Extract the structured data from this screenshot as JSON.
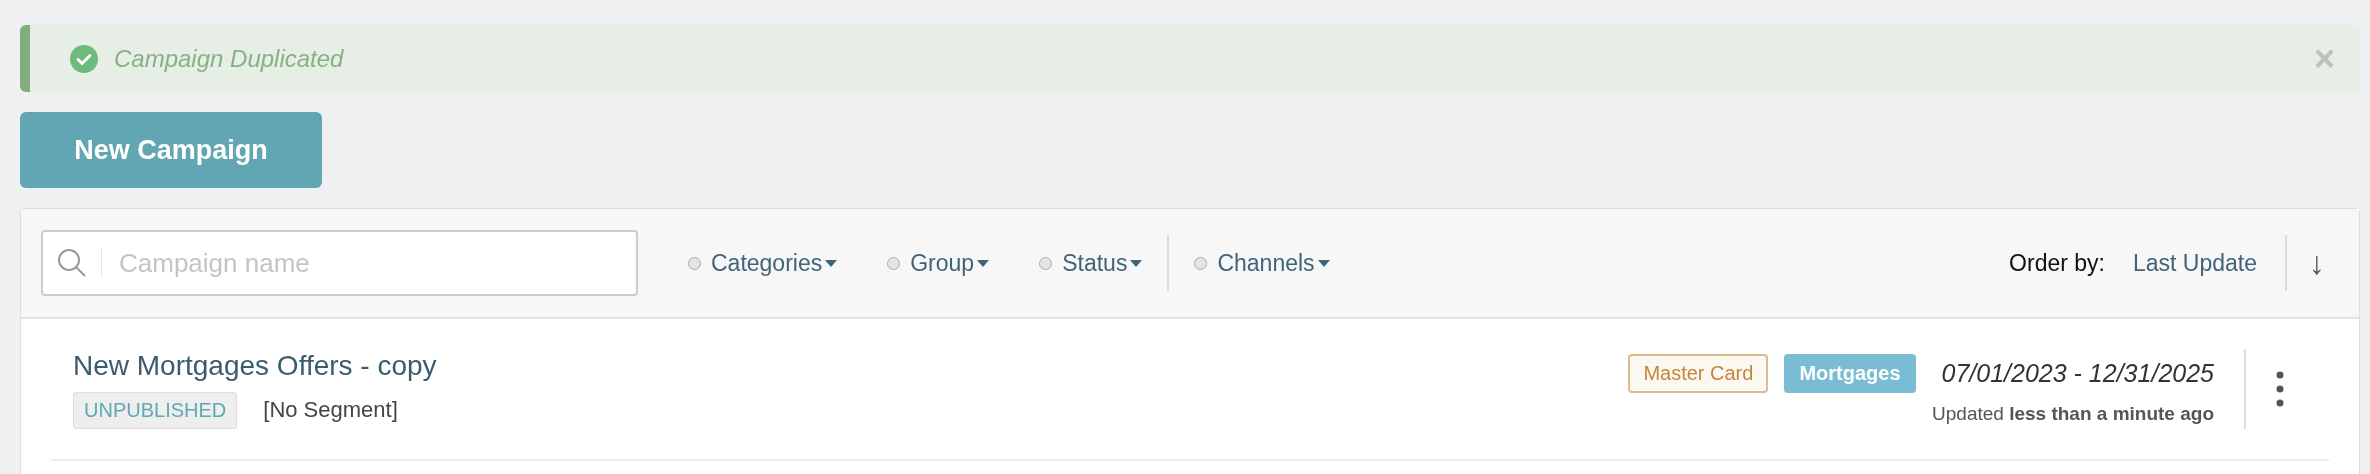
{
  "alert": {
    "message": "Campaign Duplicated",
    "close": "×"
  },
  "new_button": "New Campaign",
  "search": {
    "placeholder": "Campaign name"
  },
  "filters": [
    {
      "label": "Categories",
      "selected": false
    },
    {
      "label": "Group",
      "selected": false
    },
    {
      "label": "Status",
      "selected": false
    },
    {
      "label": "Channels",
      "selected": false
    }
  ],
  "order": {
    "label": "Order by:",
    "value": "Last Update",
    "direction": "↓"
  },
  "campaigns": [
    {
      "title": "New Mortgages Offers - copy",
      "status": "UNPUBLISHED",
      "segment": "[No Segment]",
      "tags": [
        {
          "label": "Master Card",
          "kind": "outline",
          "color": "#c4873a"
        },
        {
          "label": "Mortgages",
          "kind": "solid",
          "color": "#7bbcd5"
        }
      ],
      "dates": "07/01/2023 - 12/31/2025",
      "updated": "Updated **less than a minute ago**"
    }
  ]
}
